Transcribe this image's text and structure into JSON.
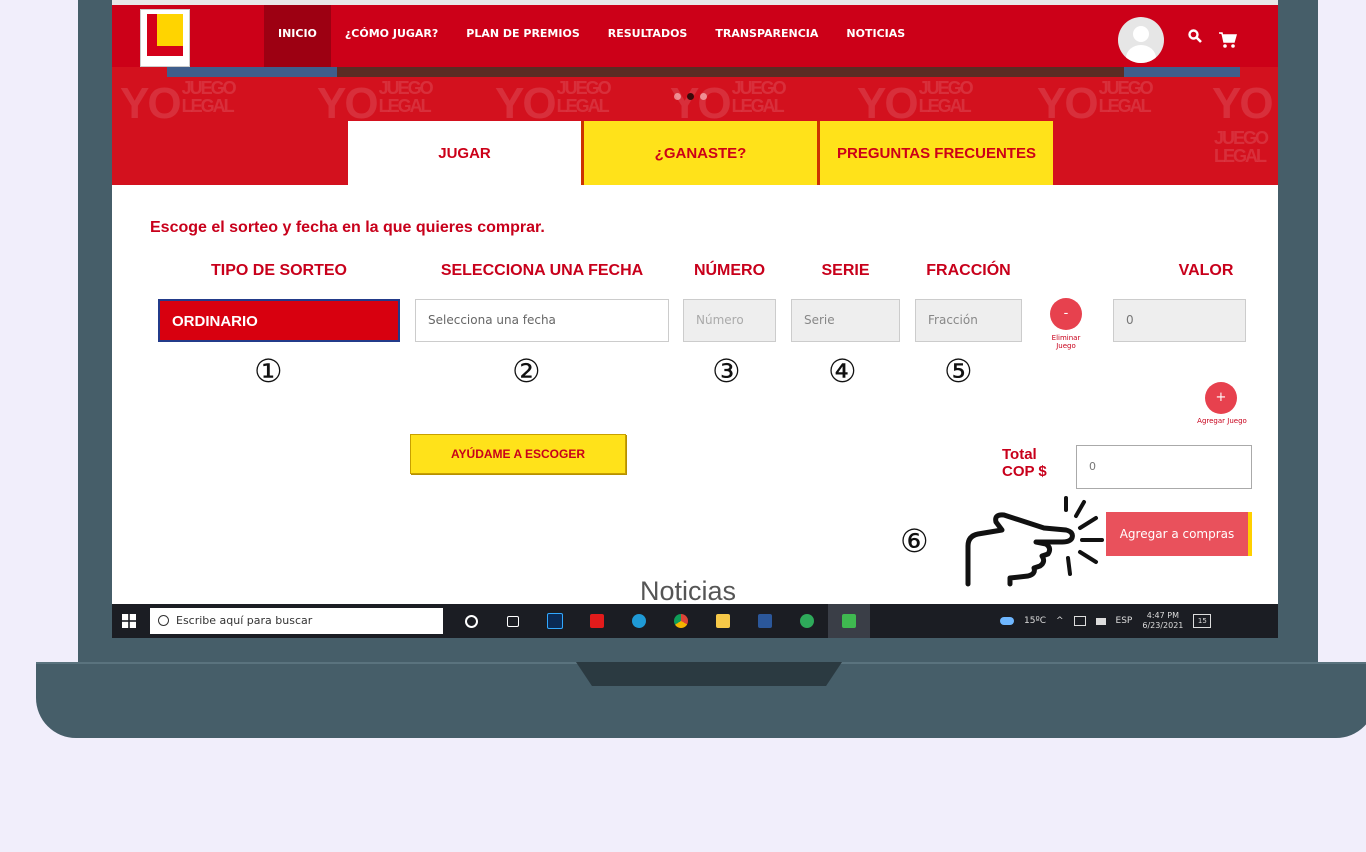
{
  "nav": {
    "items": [
      "INICIO",
      "¿CÓMO JUGAR?",
      "PLAN DE PREMIOS",
      "RESULTADOS",
      "TRANSPARENCIA",
      "NOTICIAS"
    ],
    "active_index": 0
  },
  "banner": {
    "watermark_top": "YO",
    "watermark_small_1": "JUEGO",
    "watermark_small_2": "LEGAL"
  },
  "tabs": {
    "play": "JUGAR",
    "won": "¿GANASTE?",
    "faq": "PREGUNTAS FRECUENTES"
  },
  "form": {
    "title": "Escoge el sorteo y fecha en la que quieres comprar.",
    "headers": {
      "draw_type": "TIPO DE SORTEO",
      "date": "SELECCIONA UNA FECHA",
      "number": "NÚMERO",
      "series": "SERIE",
      "fraction": "FRACCIÓN",
      "value": "VALOR"
    },
    "draw_type_value": "ORDINARIO",
    "date_placeholder": "Selecciona una fecha",
    "number_placeholder": "Número",
    "series_placeholder": "Serie",
    "fraction_placeholder": "Fracción",
    "value": "0",
    "remove_symbol": "-",
    "remove_label_1": "Eliminar",
    "remove_label_2": "Juego",
    "add_symbol": "+",
    "add_label": "Agregar Juego",
    "help_button": "AYÚDAME A ESCOGER",
    "total_label_1": "Total",
    "total_label_2": "COP $",
    "total_value": "0",
    "add_to_cart": "Agregar a compras"
  },
  "steps": [
    "①",
    "②",
    "③",
    "④",
    "⑤",
    "⑥"
  ],
  "news_heading": "Noticias",
  "taskbar": {
    "search_placeholder": "Escribe aquí para buscar",
    "temperature": "15ºC",
    "language": "ESP",
    "time": "4:47 PM",
    "date": "6/23/2021",
    "notifications": "15"
  },
  "colors": {
    "brand_red": "#cc0018",
    "tab_yellow": "#ffe21a",
    "button_coral": "#e9515c",
    "laptop_frame": "#465e69",
    "background": "#f1eefb"
  }
}
